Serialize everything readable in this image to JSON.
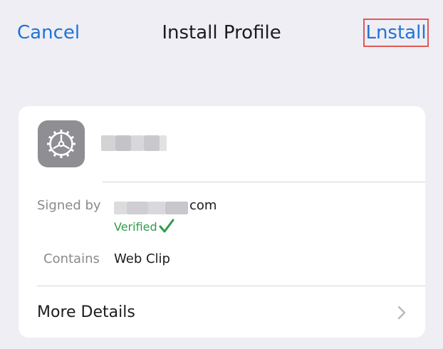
{
  "nav": {
    "cancel_label": "Cancel",
    "title": "Install Profile",
    "install_label": "Lnstall"
  },
  "profile": {
    "icon": "gear-icon",
    "name_redacted": true
  },
  "details": {
    "signed_by_label": "Signed by",
    "signed_by_suffix": "com",
    "verified_label": "Verified",
    "verified_icon": "checkmark-icon",
    "contains_label": "Contains",
    "contains_value": "Web Clip"
  },
  "more_details": {
    "label": "More Details",
    "icon": "chevron-right-icon"
  },
  "colors": {
    "background": "#efeef4",
    "accent": "#1f73d6",
    "verified": "#2f9c4c",
    "highlight_box": "#e05959"
  }
}
